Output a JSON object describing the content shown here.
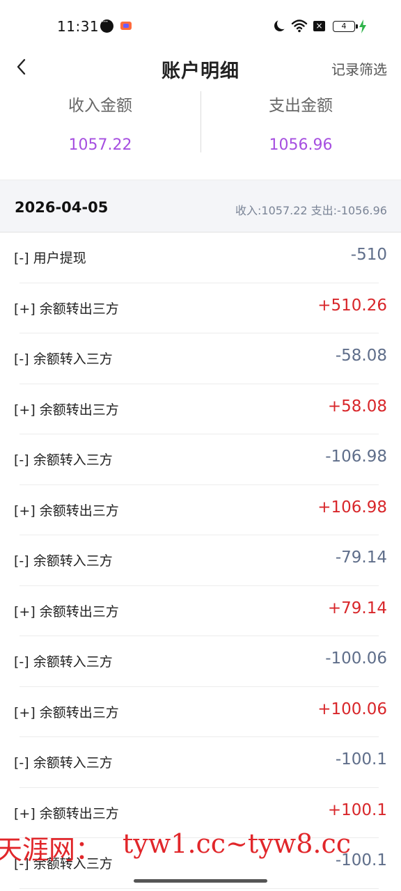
{
  "status_bar": {
    "time": "11:31",
    "battery_level": "4",
    "icons": [
      "message-icon",
      "app-notification-icon",
      "moon-icon",
      "wifi-icon",
      "sim-icon",
      "battery-icon",
      "charging-icon"
    ]
  },
  "header": {
    "title": "账户明细",
    "filter_label": "记录筛选",
    "back_icon": "chevron-left-icon"
  },
  "summary": {
    "income_label": "收入金额",
    "income_value": "1057.22",
    "expense_label": "支出金额",
    "expense_value": "1056.96",
    "value_color": "#a64fe0"
  },
  "day_group": {
    "date": "2026-04-05",
    "summary": "收入:1057.22  支出:-1056.96"
  },
  "transactions": [
    {
      "label": "[-] 用户提现",
      "amount": "-510",
      "type": "out"
    },
    {
      "label": "[+] 余额转出三方",
      "amount": "+510.26",
      "type": "in"
    },
    {
      "label": "[-] 余额转入三方",
      "amount": "-58.08",
      "type": "out"
    },
    {
      "label": "[+] 余额转出三方",
      "amount": "+58.08",
      "type": "in"
    },
    {
      "label": "[-] 余额转入三方",
      "amount": "-106.98",
      "type": "out"
    },
    {
      "label": "[+] 余额转出三方",
      "amount": "+106.98",
      "type": "in"
    },
    {
      "label": "[-] 余额转入三方",
      "amount": "-79.14",
      "type": "out"
    },
    {
      "label": "[+] 余额转出三方",
      "amount": "+79.14",
      "type": "in"
    },
    {
      "label": "[-] 余额转入三方",
      "amount": "-100.06",
      "type": "out"
    },
    {
      "label": "[+] 余额转出三方",
      "amount": "+100.06",
      "type": "in"
    },
    {
      "label": "[-] 余额转入三方",
      "amount": "-100.1",
      "type": "out"
    },
    {
      "label": "[+] 余额转出三方",
      "amount": "+100.1",
      "type": "in"
    },
    {
      "label": "[-] 余额转入三方",
      "amount": "-100.1",
      "type": "out"
    }
  ],
  "colors": {
    "income": "#d8262a",
    "expense": "#5f6e8a"
  },
  "watermark": {
    "left": "天涯网：",
    "right": "tyw1.cc~tyw8.cc"
  }
}
